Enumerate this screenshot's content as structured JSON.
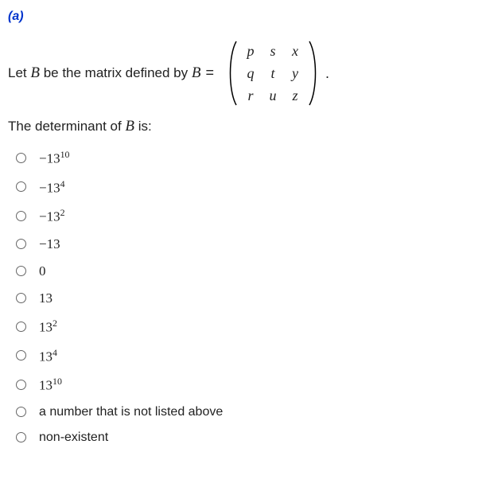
{
  "part_label": "(a)",
  "stem": {
    "lead": "Let ",
    "var_B_1": "B",
    "mid": " be the matrix defined by  ",
    "var_B_2": "B",
    "eq": "=",
    "period": "."
  },
  "matrix": {
    "r0c0": "p",
    "r0c1": "s",
    "r0c2": "x",
    "r1c0": "q",
    "r1c1": "t",
    "r1c2": "y",
    "r2c0": "r",
    "r2c1": "u",
    "r2c2": "z"
  },
  "question2": {
    "lead": "The determinant of ",
    "var_B": "B",
    "tail": " is:"
  },
  "options": {
    "o1_base": "−13",
    "o1_exp": "10",
    "o2_base": "−13",
    "o2_exp": "4",
    "o3_base": "−13",
    "o3_exp": "2",
    "o4": "−13",
    "o5": "0",
    "o6": "13",
    "o7_base": "13",
    "o7_exp": "2",
    "o8_base": "13",
    "o8_exp": "4",
    "o9_base": "13",
    "o9_exp": "10",
    "o10": "a number that is not listed above",
    "o11": "non-existent"
  }
}
